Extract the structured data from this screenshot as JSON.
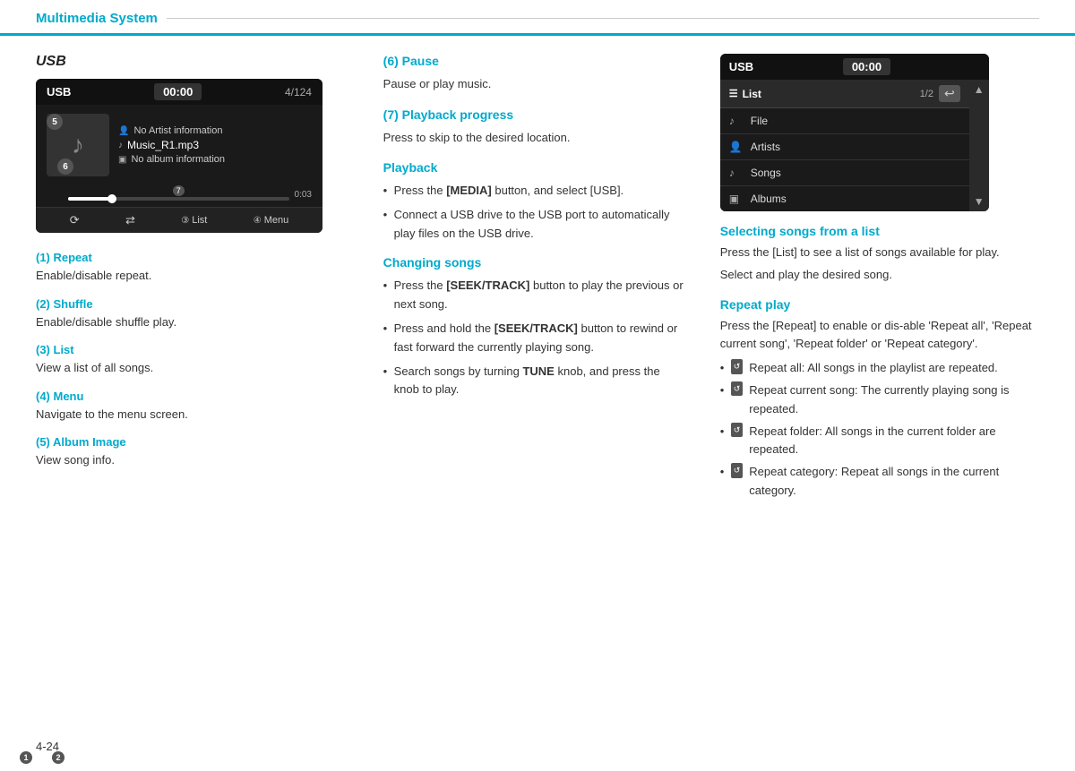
{
  "header": {
    "title": "Multimedia System"
  },
  "left": {
    "section_title": "USB",
    "usb_ui": {
      "label": "USB",
      "time": "00:00",
      "track_count": "4/124",
      "artist": "No Artist information",
      "song": "Music_R1.mp3",
      "album": "No album information",
      "time_end": "0:03",
      "btn1_label": "List",
      "btn2_label": "Menu",
      "num5": "5",
      "num6": "6",
      "num7": "7",
      "btn1_num": "3",
      "btn2_num": "4",
      "btn_repeat_num": "1",
      "btn_shuffle_num": "2"
    },
    "items": [
      {
        "heading": "(1) Repeat",
        "desc": "Enable/disable repeat."
      },
      {
        "heading": "(2) Shuffle",
        "desc": "Enable/disable shuffle play."
      },
      {
        "heading": "(3) List",
        "desc": "View a list of all songs."
      },
      {
        "heading": "(4) Menu",
        "desc": "Navigate to the menu screen."
      },
      {
        "heading": "(5) Album Image",
        "desc": "View song info."
      }
    ]
  },
  "center": {
    "pause_heading": "(6) Pause",
    "pause_desc": "Pause or play music.",
    "playback_heading": "(7) Playback progress",
    "playback_desc": "Press to skip to the desired location.",
    "playback_section_heading": "Playback",
    "playback_bullets": [
      {
        "text_before": "Press the ",
        "bold": "[MEDIA]",
        "text_after": " button, and select [USB]."
      },
      {
        "text_before": "Connect a USB drive to the USB port to automatically play files on the USB drive.",
        "bold": "",
        "text_after": ""
      }
    ],
    "changing_heading": "Changing songs",
    "changing_bullets": [
      {
        "text_before": "Press the ",
        "bold": "[SEEK/TRACK]",
        "text_after": " button to play the previous or next song."
      },
      {
        "text_before": "Press and hold the ",
        "bold": "[SEEK/TRACK]",
        "text_after": " button to rewind or fast forward the currently playing song."
      },
      {
        "text_before": "Search songs by turning ",
        "bold": "TUNE",
        "text_after": " knob, and press the knob to play."
      }
    ]
  },
  "right": {
    "usb_list_ui": {
      "label": "USB",
      "time": "00:00",
      "list_header": "List",
      "page": "1/2",
      "items": [
        {
          "icon": "♪",
          "label": "File"
        },
        {
          "icon": "♟",
          "label": "Artists"
        },
        {
          "icon": "♪",
          "label": "Songs"
        },
        {
          "icon": "♟",
          "label": "Albums"
        }
      ]
    },
    "selecting_heading": "Selecting songs from a list",
    "selecting_desc1": "Press the [List] to see a list of songs available for play.",
    "selecting_desc2": "Select and play the desired song.",
    "repeat_heading": "Repeat play",
    "repeat_desc": "Press the [Repeat] to enable or dis-able 'Repeat all', 'Repeat current song', 'Repeat folder' or 'Repeat category'.",
    "repeat_bullets": [
      {
        "icon": "↺",
        "text": "Repeat all: All songs in the playlist are repeated."
      },
      {
        "icon": "↺",
        "text": "Repeat current song: The currently playing song is repeated."
      },
      {
        "icon": "↺",
        "text": "Repeat folder: All songs in the current folder are repeated."
      },
      {
        "icon": "↺",
        "text": "Repeat category: Repeat all songs in the current category."
      }
    ]
  },
  "footer": {
    "page_number": "4-24"
  }
}
